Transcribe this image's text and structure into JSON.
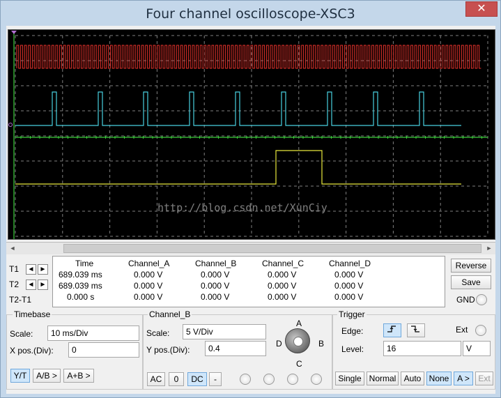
{
  "window": {
    "title": "Four channel oscilloscope-XSC3",
    "close_glyph": "✕"
  },
  "scope": {
    "watermark": "http://blog.csdn.net/XunCiy",
    "colors": {
      "channel_a": "#e8322c",
      "channel_b": "#48d0e0",
      "channel_c": "#3ccf3c",
      "channel_d": "#e8e83c",
      "grid": "#808080",
      "cursor": "#3ccf3c"
    }
  },
  "scrollbar": {
    "left_glyph": "◄",
    "right_glyph": "►"
  },
  "cursors": {
    "t1_label": "T1",
    "t2_label": "T2",
    "diff_label": "T2-T1",
    "left_glyph": "◄",
    "right_glyph": "►"
  },
  "readout": {
    "headers": [
      "Time",
      "Channel_A",
      "Channel_B",
      "Channel_C",
      "Channel_D"
    ],
    "rows": [
      [
        "689.039 ms",
        "0.000 V",
        "0.000 V",
        "0.000 V",
        "0.000 V"
      ],
      [
        "689.039 ms",
        "0.000 V",
        "0.000 V",
        "0.000 V",
        "0.000 V"
      ],
      [
        "0.000 s",
        "0.000 V",
        "0.000 V",
        "0.000 V",
        "0.000 V"
      ]
    ]
  },
  "side": {
    "reverse": "Reverse",
    "save": "Save",
    "gnd": "GND"
  },
  "timebase": {
    "title": "Timebase",
    "scale_label": "Scale:",
    "scale_value": "10 ms/Div",
    "xpos_label": "X pos.(Div):",
    "xpos_value": "0",
    "buttons": [
      "Y/T",
      "A/B >",
      "A+B >"
    ]
  },
  "channel": {
    "title": "Channel_B",
    "scale_label": "Scale:",
    "scale_value": "5  V/Div",
    "ypos_label": "Y pos.(Div):",
    "ypos_value": "0.4",
    "coupling": [
      "AC",
      "0",
      "DC",
      "-"
    ],
    "knob_labels": {
      "a": "A",
      "b": "B",
      "c": "C",
      "d": "D"
    }
  },
  "trigger": {
    "title": "Trigger",
    "edge_label": "Edge:",
    "ext_label": "Ext",
    "level_label": "Level:",
    "level_value": "16",
    "level_unit": "V",
    "modes": [
      "Single",
      "Normal",
      "Auto",
      "None",
      "A >",
      "Ext"
    ]
  }
}
